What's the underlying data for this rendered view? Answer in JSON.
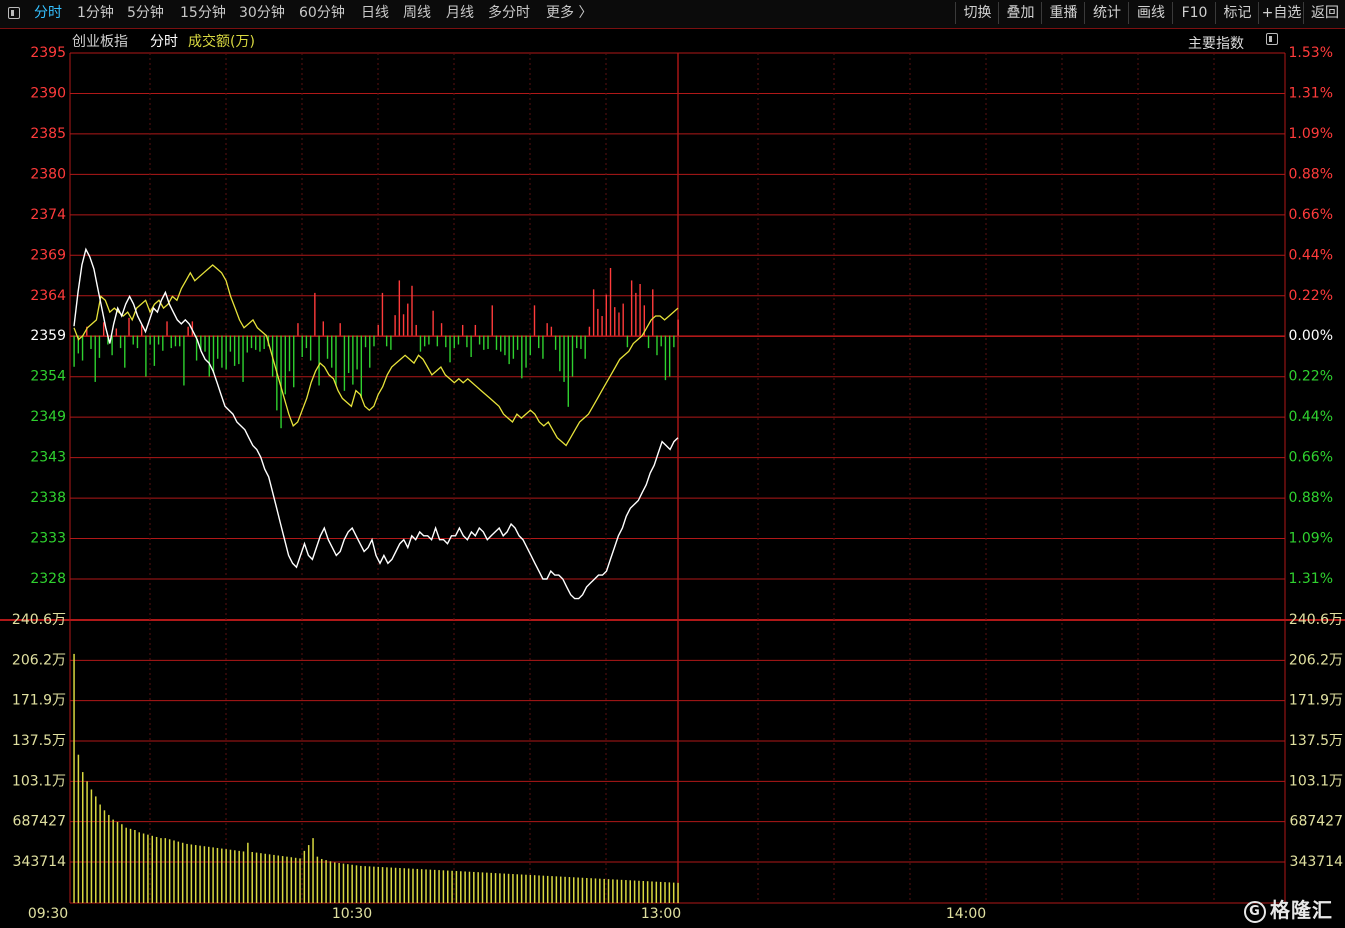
{
  "toolbar": {
    "periods": [
      {
        "label": "分时",
        "active": true
      },
      {
        "label": "1分钟",
        "active": false
      },
      {
        "label": "5分钟",
        "active": false
      },
      {
        "label": "15分钟",
        "active": false
      },
      {
        "label": "30分钟",
        "active": false
      },
      {
        "label": "60分钟",
        "active": false
      },
      {
        "label": "日线",
        "active": false
      },
      {
        "label": "周线",
        "active": false
      },
      {
        "label": "月线",
        "active": false
      },
      {
        "label": "多分时",
        "active": false
      },
      {
        "label": "更多 〉",
        "active": false
      }
    ],
    "actions": [
      "切换",
      "叠加",
      "重播",
      "统计",
      "画线",
      "F10",
      "标记",
      "+自选",
      "返回"
    ]
  },
  "chart_header": {
    "index_name": "创业板指",
    "mode": "分时",
    "volume_label": "成交额(万)",
    "main_index_label": "主要指数"
  },
  "colors": {
    "background": "#000000",
    "grid": "#b01818",
    "up": "#ff3b3b",
    "down": "#2fd12f",
    "price_line": "#ffffff",
    "avg_line": "#e6e23a",
    "volume_bar": "#d8d840",
    "active_tab": "#35c0ff"
  },
  "chart_data": {
    "type": "line",
    "price_axis": {
      "ticks": [
        2395,
        2390,
        2385,
        2380,
        2374,
        2369,
        2364,
        2359,
        2354,
        2349,
        2343,
        2338,
        2333,
        2328
      ],
      "pct_labels": [
        "1.53%",
        "1.31%",
        "1.09%",
        "0.88%",
        "0.66%",
        "0.44%",
        "0.22%",
        "0.00%",
        "0.22%",
        "0.44%",
        "0.66%",
        "0.88%",
        "1.09%",
        "1.31%"
      ],
      "reference": 2359,
      "ylim": [
        2326,
        2397
      ]
    },
    "volume_axis": {
      "ticks": [
        "240.6万",
        "206.2万",
        "171.9万",
        "137.5万",
        "103.1万",
        "687427",
        "343714"
      ],
      "ylim": [
        0,
        2406000
      ]
    },
    "time_axis": {
      "labels": [
        "09:30",
        "10:30",
        "13:00",
        "14:00"
      ],
      "sessions": [
        [
          "09:30",
          "11:30"
        ],
        [
          "13:00",
          "15:00"
        ]
      ]
    },
    "series": [
      {
        "key": "price",
        "values": [
          2360.2,
          2364.5,
          2368.0,
          2370.0,
          2369.0,
          2367.5,
          2365.0,
          2362.5,
          2360.0,
          2358.0,
          2360.5,
          2362.5,
          2361.5,
          2363.0,
          2364.0,
          2363.0,
          2361.5,
          2360.5,
          2359.5,
          2361.0,
          2362.5,
          2362.0,
          2363.5,
          2364.5,
          2363.0,
          2362.0,
          2361.0,
          2360.5,
          2361.0,
          2360.5,
          2359.5,
          2358.5,
          2357.0,
          2356.0,
          2355.5,
          2354.5,
          2353.0,
          2351.5,
          2350.0,
          2349.5,
          2349.0,
          2348.0,
          2347.5,
          2347.0,
          2346.0,
          2345.0,
          2344.5,
          2343.5,
          2342.0,
          2341.0,
          2339.0,
          2337.0,
          2335.0,
          2333.0,
          2331.0,
          2330.0,
          2329.5,
          2331.0,
          2332.5,
          2331.0,
          2330.5,
          2332.0,
          2333.5,
          2334.5,
          2333.0,
          2332.0,
          2331.0,
          2331.5,
          2333.0,
          2334.0,
          2334.5,
          2333.5,
          2332.5,
          2331.5,
          2332.0,
          2333.0,
          2331.0,
          2330.0,
          2331.0,
          2330.0,
          2330.5,
          2331.5,
          2332.5,
          2333.0,
          2332.0,
          2333.5,
          2333.0,
          2334.0,
          2333.5,
          2333.5,
          2333.0,
          2334.5,
          2333.0,
          2333.0,
          2332.5,
          2333.5,
          2333.5,
          2334.5,
          2333.5,
          2333.0,
          2334.0,
          2333.5,
          2334.5,
          2334.0,
          2333.0,
          2333.5,
          2334.0,
          2334.5,
          2333.5,
          2334.0,
          2335.0,
          2334.5,
          2333.5,
          2333.0,
          2332.0,
          2331.0,
          2330.0,
          2329.0,
          2328.0,
          2328.0,
          2329.0,
          2328.5,
          2328.5,
          2328.0,
          2327.0,
          2326.0,
          2325.5,
          2325.5,
          2326.0,
          2327.0,
          2327.5,
          2328.0,
          2328.5,
          2328.5,
          2329.0,
          2330.5,
          2332.0,
          2333.5,
          2334.5,
          2336.0,
          2337.0,
          2337.5,
          2338.0,
          2339.0,
          2340.0,
          2341.5,
          2342.5,
          2344.0,
          2345.5,
          2345.0,
          2344.5,
          2345.5,
          2346.0
        ]
      },
      {
        "key": "average",
        "values": [
          2360.0,
          2358.5,
          2359.0,
          2360.0,
          2360.5,
          2361.0,
          2364.0,
          2363.5,
          2362.0,
          2362.5,
          2362.0,
          2361.5,
          2362.0,
          2361.0,
          2362.5,
          2363.0,
          2363.5,
          2362.0,
          2363.0,
          2363.5,
          2362.5,
          2363.0,
          2364.0,
          2363.5,
          2365.0,
          2366.0,
          2367.0,
          2366.0,
          2366.5,
          2367.0,
          2367.5,
          2368.0,
          2367.5,
          2367.0,
          2366.0,
          2364.0,
          2362.5,
          2361.0,
          2360.0,
          2360.5,
          2361.0,
          2360.0,
          2359.5,
          2359.0,
          2357.0,
          2355.0,
          2353.0,
          2351.0,
          2349.0,
          2347.5,
          2348.0,
          2349.5,
          2351.0,
          2353.0,
          2354.5,
          2355.5,
          2355.0,
          2354.0,
          2353.5,
          2352.0,
          2351.0,
          2350.5,
          2350.0,
          2352.0,
          2351.5,
          2350.0,
          2349.5,
          2350.0,
          2351.5,
          2352.5,
          2354.0,
          2355.0,
          2355.5,
          2356.0,
          2356.5,
          2356.0,
          2355.5,
          2356.5,
          2356.0,
          2355.0,
          2354.0,
          2354.5,
          2355.0,
          2354.0,
          2353.5,
          2353.0,
          2353.5,
          2353.0,
          2353.5,
          2353.0,
          2352.5,
          2352.0,
          2351.5,
          2351.0,
          2350.5,
          2350.0,
          2349.0,
          2348.5,
          2348.0,
          2349.0,
          2348.5,
          2349.0,
          2349.5,
          2349.0,
          2348.0,
          2347.5,
          2348.0,
          2347.0,
          2346.0,
          2345.5,
          2345.0,
          2346.0,
          2347.0,
          2348.0,
          2348.5,
          2349.0,
          2350.0,
          2351.0,
          2352.0,
          2353.0,
          2354.0,
          2355.0,
          2356.0,
          2356.5,
          2357.0,
          2358.0,
          2358.5,
          2359.0,
          2360.0,
          2361.0,
          2361.5,
          2361.5,
          2361.0,
          2361.5,
          2362.0,
          2362.5
        ]
      },
      {
        "key": "change_bars",
        "values": [
          -3.5,
          -2.0,
          -2.8,
          1.0,
          -1.5,
          -5.2,
          -2.5,
          1.5,
          -1.0,
          -2.2,
          0.8,
          -1.4,
          -3.6,
          2.0,
          -1.0,
          -1.4,
          1.2,
          -4.6,
          -1.0,
          -3.4,
          -1.0,
          -1.7,
          1.6,
          -1.4,
          -1.2,
          -1.2,
          -5.6,
          1.0,
          1.6,
          -2.8,
          -1.6,
          -1.8,
          -4.6,
          -4.2,
          -2.6,
          -3.6,
          -3.8,
          -1.8,
          -3.4,
          -3.2,
          -5.2,
          -1.9,
          -1.4,
          -1.6,
          -1.8,
          -1.5,
          -1.2,
          -4.6,
          -8.4,
          -10.4,
          -6.6,
          -4.0,
          -5.8,
          1.4,
          -2.4,
          -1.4,
          -2.8,
          4.8,
          -5.6,
          1.6,
          -2.6,
          -3.6,
          -5.6,
          1.4,
          -6.2,
          -4.2,
          -5.5,
          -3.8,
          -7.0,
          -1.3,
          -3.6,
          -1.2,
          1.2,
          4.8,
          -1.2,
          -1.6,
          2.3,
          6.2,
          2.4,
          3.6,
          5.6,
          1.2,
          -1.8,
          -1.2,
          -1.0,
          2.8,
          -1.2,
          1.4,
          -1.3,
          -3.0,
          -1.4,
          -1.0,
          1.2,
          -1.3,
          -2.4,
          1.2,
          -1.0,
          -1.6,
          -1.5,
          3.4,
          -1.6,
          -1.8,
          -2.2,
          -3.2,
          -2.6,
          -1.6,
          -4.8,
          -3.6,
          -2.2,
          3.4,
          -1.4,
          -2.6,
          1.4,
          1.0,
          -1.6,
          -4.0,
          -5.2,
          -8.0,
          -4.6,
          -1.4,
          -1.5,
          -2.6,
          1.0,
          5.2,
          3.0,
          2.2,
          4.6,
          7.6,
          3.2,
          2.6,
          3.6,
          -1.3,
          6.2,
          4.8,
          5.8,
          3.4,
          -1.4,
          5.2,
          -2.2,
          -1.2,
          -5.0,
          -4.6,
          -1.3,
          1.8
        ]
      },
      {
        "key": "volume",
        "values": [
          2150000,
          1280000,
          1130000,
          1050000,
          980000,
          920000,
          850000,
          800000,
          760000,
          720000,
          700000,
          680000,
          650000,
          640000,
          630000,
          610000,
          600000,
          590000,
          580000,
          570000,
          560000,
          560000,
          550000,
          540000,
          530000,
          520000,
          510000,
          505000,
          500000,
          495000,
          490000,
          485000,
          480000,
          475000,
          470000,
          465000,
          460000,
          455000,
          450000,
          445000,
          520000,
          440000,
          435000,
          430000,
          425000,
          420000,
          415000,
          410000,
          405000,
          400000,
          395000,
          390000,
          385000,
          450000,
          500000,
          560000,
          400000,
          380000,
          370000,
          360000,
          350000,
          345000,
          340000,
          335000,
          330000,
          325000,
          320000,
          318000,
          316000,
          314000,
          312000,
          310000,
          308000,
          306000,
          304000,
          302000,
          300000,
          298000,
          296000,
          294000,
          292000,
          290000,
          288000,
          286000,
          284000,
          282000,
          280000,
          278000,
          276000,
          274000,
          272000,
          270000,
          268000,
          266000,
          264000,
          262000,
          260000,
          258000,
          256000,
          254000,
          252000,
          250000,
          248000,
          246000,
          244000,
          242000,
          240000,
          238000,
          236000,
          234000,
          232000,
          230000,
          228000,
          226000,
          224000,
          222000,
          220000,
          218000,
          216000,
          214000,
          212000,
          210000,
          208000,
          206000,
          204000,
          202000,
          200000,
          198000,
          196000,
          194000,
          192000,
          190000,
          188000,
          186000,
          184000,
          182000,
          180000,
          178000,
          176000,
          174000
        ]
      }
    ]
  }
}
